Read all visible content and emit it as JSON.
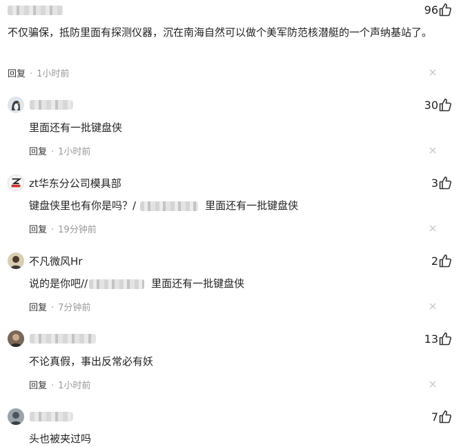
{
  "comments": [
    {
      "username": "",
      "likes": "96",
      "text": "不仅骗保，抵防里面有探测仪器，沉在南海自然可以做个美军防范核潜艇的一个声纳基站了。",
      "reply_label": "回复",
      "time": "1小时前"
    },
    {
      "username": "",
      "likes": "30",
      "text": "里面还有一批键盘侠",
      "reply_label": "回复",
      "time": "1小时前"
    },
    {
      "username": "zt华东分公司模具部",
      "likes": "3",
      "text_before": "键盘侠里也有你是吗？/",
      "text_after": "里面还有一批键盘侠",
      "reply_label": "回复",
      "time": "19分钟前"
    },
    {
      "username": "不凡微风Hr",
      "likes": "2",
      "text_before": "说的是你吧//",
      "text_after": "里面还有一批键盘侠",
      "reply_label": "回复",
      "time": "7分钟前"
    },
    {
      "username": "",
      "likes": "13",
      "text": "不论真假，事出反常必有妖",
      "reply_label": "回复",
      "time": "1小时前"
    },
    {
      "username": "",
      "likes": "7",
      "text": "头也被夹过吗"
    }
  ],
  "icons": {
    "like": "thumbs-up-icon",
    "close": "close-icon"
  },
  "colors": {
    "text": "#222222",
    "meta": "#999999",
    "icon": "#333333"
  }
}
